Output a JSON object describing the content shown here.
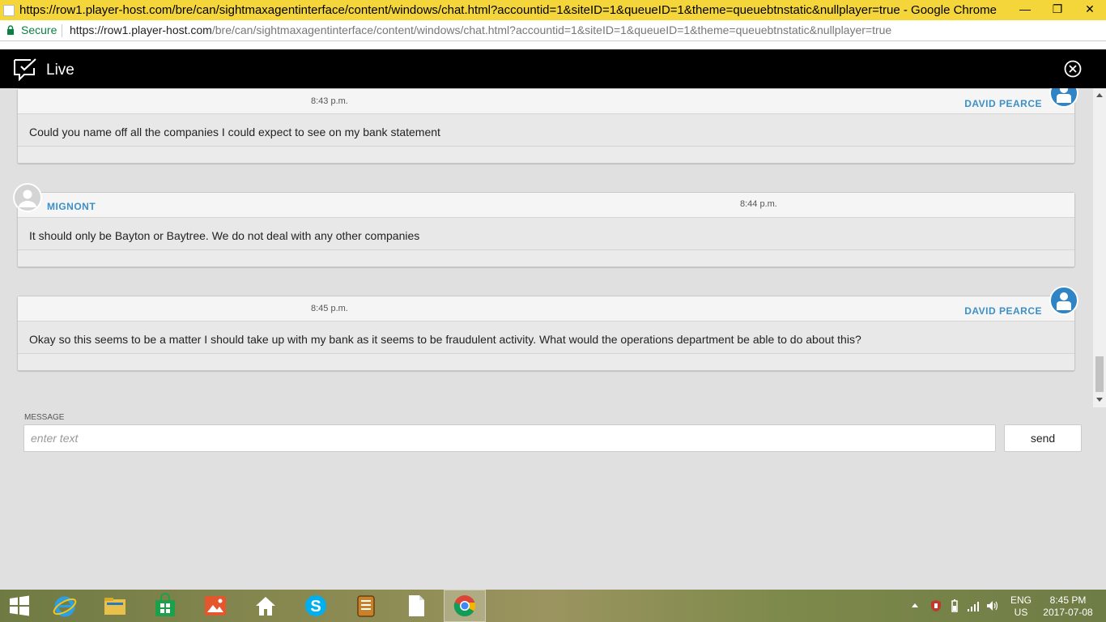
{
  "browser": {
    "window_title": "https://row1.player-host.com/bre/can/sightmaxagentinterface/content/windows/chat.html?accountid=1&siteID=1&queueID=1&theme=queuebtnstatic&nullplayer=true - Google Chrome",
    "secure_label": "Secure",
    "url_host": "https://row1.player-host.com",
    "url_path": "/bre/can/sightmaxagentinterface/content/windows/chat.html?accountid=1&siteID=1&queueID=1&theme=queuebtnstatic&nullplayer=true"
  },
  "header": {
    "title": "Live"
  },
  "messages": [
    {
      "time": "8:43 p.m.",
      "author": "DAVID PEARCE",
      "text": "Could you name off all the companies I could expect to see on my bank statement"
    },
    {
      "time": "8:44 p.m.",
      "author": "MIGNONT",
      "text": "It should only be Bayton or Baytree. We do not deal with any other companies"
    },
    {
      "time": "8:45 p.m.",
      "author": "DAVID PEARCE",
      "text": "Okay so this seems to be a matter I should take up with my bank as it seems to be fraudulent activity. What would the operations department be able to do about this?"
    }
  ],
  "composer": {
    "label": "MESSAGE",
    "placeholder": "enter text",
    "send_label": "send"
  },
  "taskbar": {
    "lang_line1": "ENG",
    "lang_line2": "US",
    "time": "8:45 PM",
    "date": "2017-07-08"
  },
  "colors": {
    "accent_name": "#3c8fc7",
    "title_bar": "#f5d63a",
    "live_bar": "#000000"
  }
}
